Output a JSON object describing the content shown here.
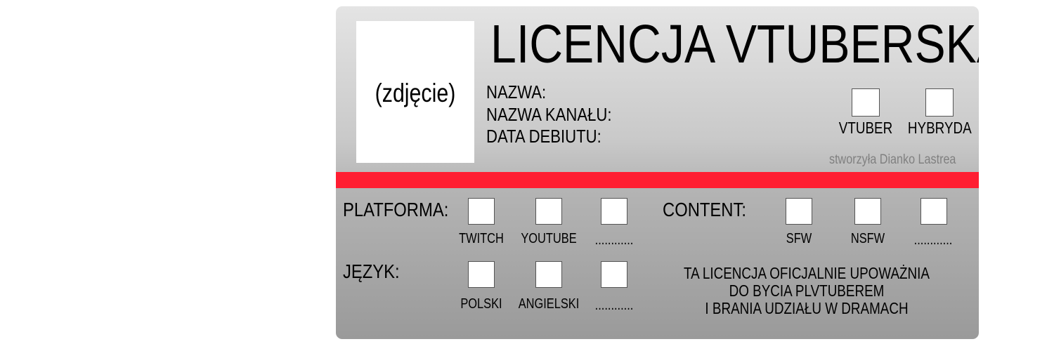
{
  "card": {
    "photo_label": "(zdjęcie)",
    "title": "LICENCJA VTUBERSKA",
    "fields": [
      "NAZWA:",
      "NAZWA KANAŁU:",
      "DATA DEBIUTU:"
    ],
    "type_options": [
      "VTUBER",
      "HYBRYDA"
    ],
    "credit": "stworzyła Dianko Lastrea",
    "stripe_color": "#ff1e32"
  },
  "platform": {
    "label": "PLATFORMA:",
    "options": [
      "TWITCH",
      "YOUTUBE",
      "............"
    ]
  },
  "content": {
    "label": "CONTENT:",
    "options": [
      "SFW",
      "NSFW",
      "............"
    ]
  },
  "language": {
    "label": "JĘZYK:",
    "options": [
      "POLSKI",
      "ANGIELSKI",
      "............"
    ]
  },
  "notice": {
    "lines": [
      "TA LICENCJA OFICJALNIE UPOWAŻNIA",
      "DO BYCIA PLVTUBEREM",
      "I BRANIA UDZIAŁU W DRAMACH"
    ]
  }
}
